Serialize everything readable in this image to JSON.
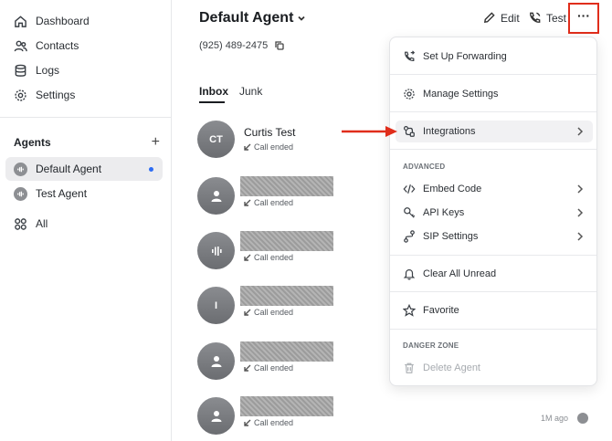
{
  "sidebar": {
    "nav": [
      {
        "label": "Dashboard",
        "icon": "home-icon"
      },
      {
        "label": "Contacts",
        "icon": "users-icon"
      },
      {
        "label": "Logs",
        "icon": "database-icon"
      },
      {
        "label": "Settings",
        "icon": "gear-icon"
      }
    ],
    "agents_title": "Agents",
    "add_label": "+",
    "agents": [
      {
        "label": "Default Agent",
        "active": true
      },
      {
        "label": "Test Agent",
        "active": false
      }
    ],
    "all_label": "All"
  },
  "header": {
    "title": "Default Agent",
    "phone": "(925) 489-2475",
    "edit_label": "Edit",
    "test_label": "Test",
    "more_label": "···"
  },
  "tabs": [
    {
      "label": "Inbox",
      "active": true
    },
    {
      "label": "Junk",
      "active": false
    }
  ],
  "conversations": [
    {
      "initials": "CT",
      "name": "Curtis Test",
      "status": "Call ended",
      "avatar": "initials",
      "redacted": false
    },
    {
      "initials": "",
      "name": "",
      "status": "Call ended",
      "avatar": "person-icon",
      "redacted": true
    },
    {
      "initials": "",
      "name": "",
      "status": "Call ended",
      "avatar": "waveform-icon",
      "redacted": true
    },
    {
      "initials": "I",
      "name": "",
      "status": "Call ended",
      "avatar": "initials",
      "redacted": true
    },
    {
      "initials": "",
      "name": "",
      "status": "Call ended",
      "avatar": "person-icon",
      "redacted": true
    },
    {
      "initials": "",
      "name": "",
      "status": "Call ended",
      "avatar": "person-icon",
      "redacted": true,
      "time": "1M ago"
    }
  ],
  "menu": {
    "items": {
      "forwarding": "Set Up Forwarding",
      "manage": "Manage Settings",
      "integrations": "Integrations",
      "embed": "Embed Code",
      "api_keys": "API Keys",
      "sip": "SIP Settings",
      "clear_unread": "Clear All Unread",
      "favorite": "Favorite",
      "delete": "Delete Agent"
    },
    "section_advanced": "ADVANCED",
    "section_danger": "DANGER ZONE"
  },
  "colors": {
    "accent_blue": "#2d6cf3",
    "annotation_red": "#e02d1b"
  }
}
